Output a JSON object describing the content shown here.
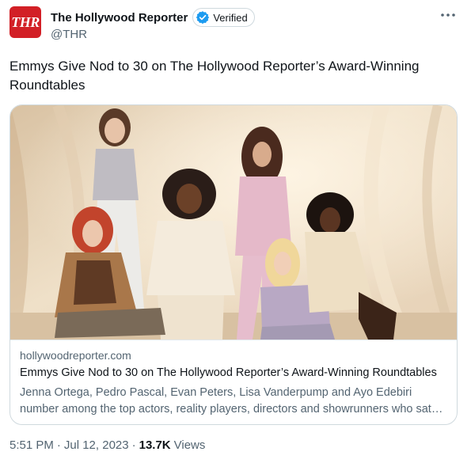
{
  "author": {
    "display_name": "The Hollywood Reporter",
    "handle": "@THR",
    "verified_label": "Verified",
    "avatar_text": "THR"
  },
  "tweet": {
    "text": "Emmys Give Nod to 30 on The Hollywood Reporter’s Award-Winning Roundtables"
  },
  "card": {
    "domain": "hollywoodreporter.com",
    "title": "Emmys Give Nod to 30 on The Hollywood Reporter’s Award-Winning Roundtables",
    "description": "Jenna Ortega, Pedro Pascal, Evan Peters, Lisa Vanderpump and Ayo Edebiri number among the top actors, reality players, directors and showrunners who sat down for THR's roundtables"
  },
  "meta": {
    "time": "5:51 PM",
    "date": "Jul 12, 2023",
    "separator": "·",
    "views_count": "13.7K",
    "views_label": "Views"
  },
  "colors": {
    "brand_red": "#d21f26",
    "verified_blue": "#1d9bf0",
    "text_primary": "#0f1419",
    "text_secondary": "#536471"
  }
}
